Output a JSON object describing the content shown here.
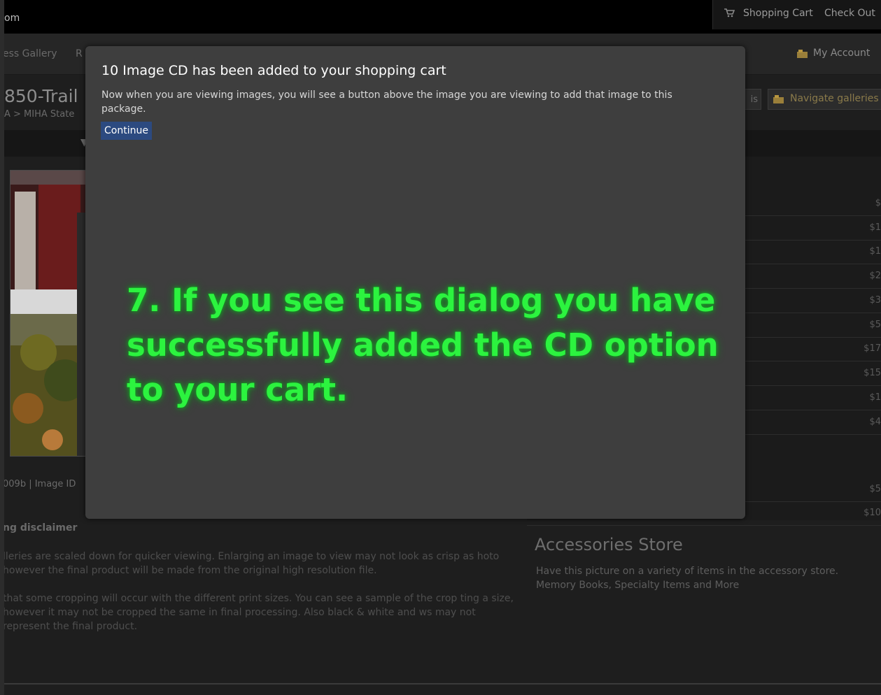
{
  "header": {
    "brand_text": "om",
    "cart_label": "Shopping Cart",
    "checkout_label": "Check Out",
    "cart_icon": "cart-icon"
  },
  "nav": {
    "gallery_label": "ess Gallery",
    "r_label": "R",
    "account_label": "My Account",
    "account_icon": "account-icon"
  },
  "gallery": {
    "title": "850-Trail",
    "breadcrumb": "A > MIHA State",
    "is_button": "is",
    "navigate_label": "Navigate galleries",
    "photo_caption": "009b | Image ID"
  },
  "pricing": {
    "prices": [
      "$",
      "$1",
      "$1",
      "$2",
      "$3",
      "$5",
      "$17",
      "$15",
      "$1",
      "$4"
    ],
    "prices_2": [
      "$5",
      "$10"
    ]
  },
  "accessories": {
    "title": "Accessories Store",
    "desc_line1": "Have this picture on a variety of items in the accessory store.",
    "desc_line2": "Memory Books, Specialty Items and More"
  },
  "disclaimer": {
    "title": "ng disclaimer",
    "p1": "lleries are scaled down for quicker viewing. Enlarging an image to view may not look as crisp as hoto however the final product will be made from the original high resolution file.",
    "p2": " that some cropping will occur with the different print sizes. You can see a sample of the crop ting a size, however it may not be cropped the same in final processing. Also black & white and ws may not represent the final product."
  },
  "modal": {
    "title": "10 Image CD has been added to your shopping cart",
    "body": "Now when you are viewing images, you will see a button above the image you are viewing to add that image to this package.",
    "continue_label": "Continue"
  },
  "annotation": {
    "text": "7. If you see this dialog you have successfully added the CD option to your cart.",
    "color": "#2cf33f"
  }
}
